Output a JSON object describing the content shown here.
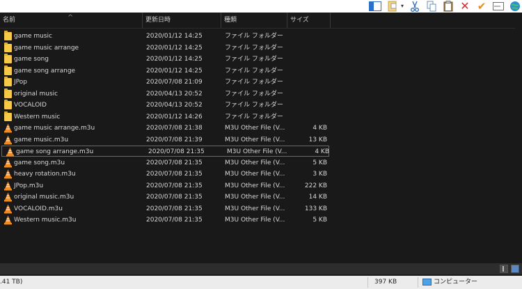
{
  "header": {
    "sort_indicator": "^",
    "columns": [
      {
        "label": "名前"
      },
      {
        "label": "更新日時"
      },
      {
        "label": "種類"
      },
      {
        "label": "サイズ"
      }
    ]
  },
  "files": [
    {
      "icon": "folder-icon",
      "name": "game music",
      "date": "2020/01/12 14:25",
      "type": "ファイル フォルダー",
      "size": ""
    },
    {
      "icon": "folder-icon",
      "name": "game music arrange",
      "date": "2020/01/12 14:25",
      "type": "ファイル フォルダー",
      "size": ""
    },
    {
      "icon": "folder-icon",
      "name": "game song",
      "date": "2020/01/12 14:25",
      "type": "ファイル フォルダー",
      "size": ""
    },
    {
      "icon": "folder-icon",
      "name": "game song arrange",
      "date": "2020/01/12 14:25",
      "type": "ファイル フォルダー",
      "size": ""
    },
    {
      "icon": "folder-icon",
      "name": "JPop",
      "date": "2020/07/08 21:09",
      "type": "ファイル フォルダー",
      "size": ""
    },
    {
      "icon": "folder-icon",
      "name": "original music",
      "date": "2020/04/13 20:52",
      "type": "ファイル フォルダー",
      "size": ""
    },
    {
      "icon": "folder-icon",
      "name": "VOCALOID",
      "date": "2020/04/13 20:52",
      "type": "ファイル フォルダー",
      "size": ""
    },
    {
      "icon": "folder-icon",
      "name": "Western music",
      "date": "2020/01/12 14:26",
      "type": "ファイル フォルダー",
      "size": ""
    },
    {
      "icon": "vlc-cone-icon",
      "name": "game music arrange.m3u",
      "date": "2020/07/08 21:38",
      "type": "M3U Other File (V...",
      "size": "4 KB"
    },
    {
      "icon": "vlc-cone-icon",
      "name": "game music.m3u",
      "date": "2020/07/08 21:39",
      "type": "M3U Other File (V...",
      "size": "13 KB"
    },
    {
      "icon": "vlc-cone-icon",
      "name": "game song arrange.m3u",
      "date": "2020/07/08 21:35",
      "type": "M3U Other File (V...",
      "size": "4 KB",
      "selected": true
    },
    {
      "icon": "vlc-cone-icon",
      "name": "game song.m3u",
      "date": "2020/07/08 21:35",
      "type": "M3U Other File (V...",
      "size": "5 KB"
    },
    {
      "icon": "vlc-cone-icon",
      "name": "heavy rotation.m3u",
      "date": "2020/07/08 21:35",
      "type": "M3U Other File (V...",
      "size": "3 KB"
    },
    {
      "icon": "vlc-cone-icon",
      "name": "JPop.m3u",
      "date": "2020/07/08 21:35",
      "type": "M3U Other File (V...",
      "size": "222 KB"
    },
    {
      "icon": "vlc-cone-icon",
      "name": "original music.m3u",
      "date": "2020/07/08 21:35",
      "type": "M3U Other File (V...",
      "size": "14 KB"
    },
    {
      "icon": "vlc-cone-icon",
      "name": "VOCALOID.m3u",
      "date": "2020/07/08 21:35",
      "type": "M3U Other File (V...",
      "size": "133 KB"
    },
    {
      "icon": "vlc-cone-icon",
      "name": "Western music.m3u",
      "date": "2020/07/08 21:35",
      "type": "M3U Other File (V...",
      "size": "5 KB"
    }
  ],
  "toolbar": {
    "icons": [
      "layout-pane-icon",
      "new-item-icon",
      "dropdown-caret-icon",
      "cut-icon",
      "copy-icon",
      "paste-icon",
      "delete-icon",
      "checkmark-icon",
      "rename-icon",
      "globe-icon"
    ]
  },
  "status": {
    "left_text": ".41 TB)",
    "size_text": "397 KB",
    "computer_text": "コンピューター"
  },
  "colors": {
    "background": "#191919",
    "text": "#d8d8d8",
    "folder": "#f7c948",
    "vlc_orange": "#f28a1e",
    "delete_red": "#d62a2a",
    "check_orange": "#e88a18",
    "status_bg": "#ececec"
  }
}
